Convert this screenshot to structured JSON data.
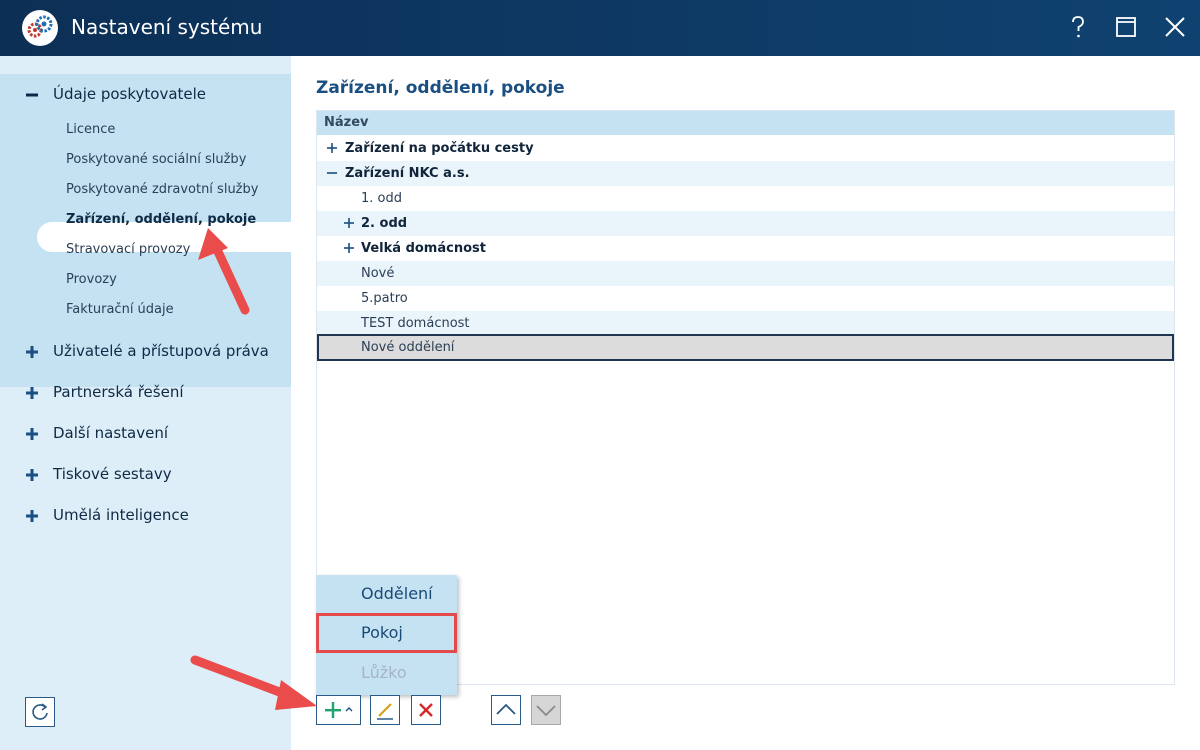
{
  "window": {
    "title": "Nastavení systému",
    "controls": [
      "help-icon",
      "maximize-icon",
      "close-icon"
    ]
  },
  "sidebar": {
    "groups": [
      {
        "label": "Údaje poskytovatele",
        "expanded": true,
        "items": [
          {
            "label": "Licence"
          },
          {
            "label": "Poskytované sociální služby"
          },
          {
            "label": "Poskytované zdravotní služby"
          },
          {
            "label": "Zařízení, oddělení, pokoje",
            "active": true
          },
          {
            "label": "Stravovací provozy"
          },
          {
            "label": "Provozy"
          },
          {
            "label": "Fakturační údaje"
          }
        ]
      },
      {
        "label": "Uživatelé a přístupová práva",
        "expanded": false
      },
      {
        "label": "Partnerská řešení",
        "expanded": false
      },
      {
        "label": "Další nastavení",
        "expanded": false
      },
      {
        "label": "Tiskové sestavy",
        "expanded": false
      },
      {
        "label": "Umělá inteligence",
        "expanded": false
      }
    ]
  },
  "main": {
    "title": "Zařízení, oddělení, pokoje",
    "grid": {
      "header": "Název",
      "rows": [
        {
          "label": "Zařízení na počátku cesty",
          "level": 0,
          "toggle": "plus",
          "bold": true
        },
        {
          "label": "Zařízení NKC a.s.",
          "level": 0,
          "toggle": "minus",
          "bold": true
        },
        {
          "label": "1. odd",
          "level": 1,
          "toggle": null,
          "bold": false
        },
        {
          "label": "2. odd",
          "level": 1,
          "toggle": "plus",
          "bold": true
        },
        {
          "label": "Velká domácnost",
          "level": 1,
          "toggle": "plus",
          "bold": true
        },
        {
          "label": "Nové",
          "level": 1,
          "toggle": null,
          "bold": false
        },
        {
          "label": "5.patro",
          "level": 1,
          "toggle": null,
          "bold": false
        },
        {
          "label": "TEST domácnost",
          "level": 1,
          "toggle": null,
          "bold": false
        },
        {
          "label": "Nové oddělení",
          "level": 1,
          "toggle": null,
          "bold": false,
          "selected": true
        }
      ]
    },
    "add_menu": {
      "items": [
        {
          "label": "Oddělení",
          "enabled": true
        },
        {
          "label": "Pokoj",
          "enabled": true,
          "highlighted": true
        },
        {
          "label": "Lůžko",
          "enabled": false
        }
      ]
    },
    "toolbar": {
      "buttons": [
        {
          "icon": "add-icon",
          "enabled": true
        },
        {
          "icon": "edit-icon",
          "enabled": true
        },
        {
          "icon": "delete-icon",
          "enabled": true
        },
        {
          "icon": "move-up-icon",
          "enabled": true
        },
        {
          "icon": "move-down-icon",
          "enabled": false
        }
      ]
    }
  },
  "colors": {
    "titlebar": "#0e3a66",
    "sidebar": "#ddeef9",
    "sidebar_expanded": "#c5e2f3",
    "accent": "#1a4f82",
    "annotation_red": "#e24b4b"
  }
}
